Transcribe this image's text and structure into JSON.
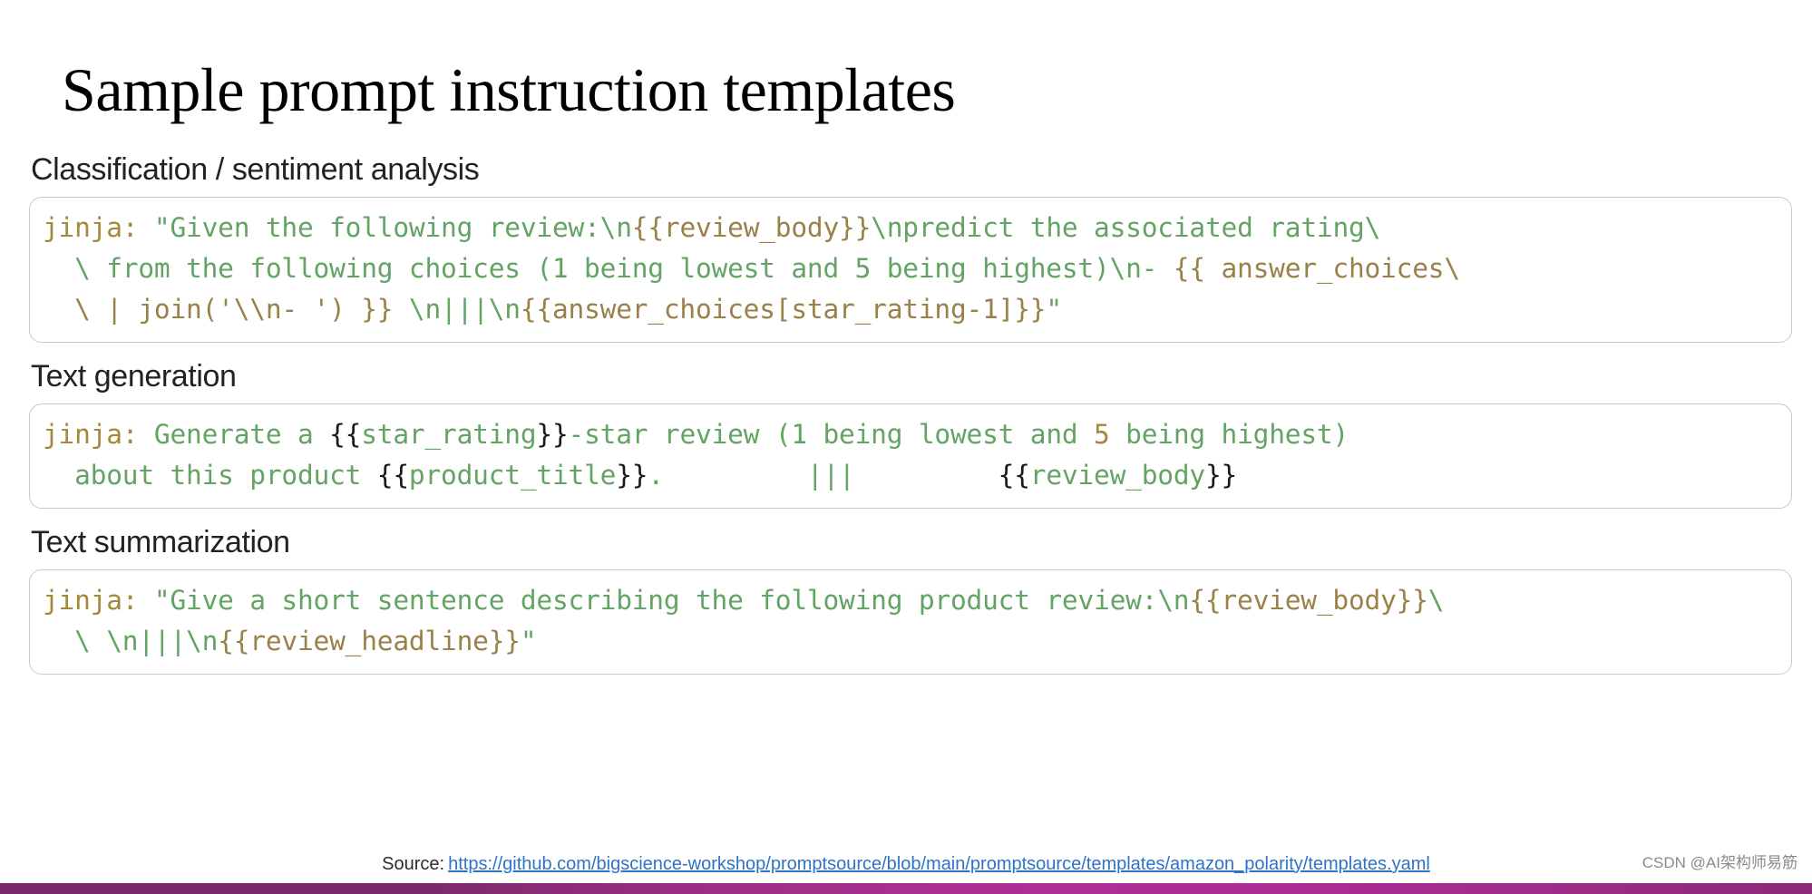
{
  "slide": {
    "title": "Sample prompt instruction templates"
  },
  "sections": [
    {
      "heading": "Classification / sentiment analysis",
      "lines": [
        {
          "plain": "jinja: \"Given the following review:\\n{{review_body}}\\npredict the associated rating\\",
          "tokens": [
            {
              "text": "jinja:",
              "type": "key"
            },
            {
              "text": " \"Given the following review:\\n",
              "type": "str"
            },
            {
              "text": "{{review_body}}",
              "type": "var"
            },
            {
              "text": "\\npredict the associated rating\\",
              "type": "str"
            }
          ]
        },
        {
          "plain": "  \\ from the following choices (1 being lowest and 5 being highest)\\n- {{ answer_choices\\",
          "tokens": [
            {
              "text": "  \\ from the following choices (1 being lowest and 5 being highest)\\n- ",
              "type": "str"
            },
            {
              "text": "{{ answer_choices\\",
              "type": "var"
            }
          ]
        },
        {
          "plain": "  \\ | join('\\\\n- ') }} \\n|||\\n{{answer_choices[star_rating-1]}}\"",
          "tokens": [
            {
              "text": "  \\ | join('\\\\n- ') }}",
              "type": "var"
            },
            {
              "text": " \\n|||\\n",
              "type": "str"
            },
            {
              "text": "{{answer_choices[star_rating-1]}}",
              "type": "var"
            },
            {
              "text": "\"",
              "type": "str"
            }
          ]
        }
      ]
    },
    {
      "heading": "Text generation",
      "lines": [
        {
          "plain": "jinja: Generate a {{star_rating}}-star review (1 being lowest and 5 being highest)",
          "tokens": [
            {
              "text": "jinja:",
              "type": "key"
            },
            {
              "text": " Generate a ",
              "type": "str"
            },
            {
              "text": "{{",
              "type": "brace"
            },
            {
              "text": "star_rating",
              "type": "str"
            },
            {
              "text": "}}",
              "type": "brace"
            },
            {
              "text": "-star review (1 being lowest and ",
              "type": "str"
            },
            {
              "text": "5",
              "type": "num"
            },
            {
              "text": " being highest)",
              "type": "str"
            }
          ]
        },
        {
          "plain": "  about this product {{product_title}}.      |||      {{review_body}}",
          "tokens": [
            {
              "text": "  about this product ",
              "type": "str"
            },
            {
              "text": "{{",
              "type": "brace"
            },
            {
              "text": "product_title",
              "type": "str"
            },
            {
              "text": "}}",
              "type": "brace"
            },
            {
              "text": ".         |||         ",
              "type": "str"
            },
            {
              "text": "{{",
              "type": "brace"
            },
            {
              "text": "review_body",
              "type": "str"
            },
            {
              "text": "}}",
              "type": "brace"
            }
          ]
        }
      ]
    },
    {
      "heading": "Text summarization",
      "lines": [
        {
          "plain": "jinja: \"Give a short sentence describing the following product review:\\n{{review_body}}\\",
          "tokens": [
            {
              "text": "jinja:",
              "type": "key"
            },
            {
              "text": " \"Give a short sentence describing the following product review:\\n",
              "type": "str"
            },
            {
              "text": "{{review_body}}",
              "type": "var"
            },
            {
              "text": "\\",
              "type": "str"
            }
          ]
        },
        {
          "plain": "  \\ \\n|||\\n{{review_headline}}\"",
          "tokens": [
            {
              "text": "  \\ ",
              "type": "str"
            },
            {
              "text": "\\n|||\\n",
              "type": "str"
            },
            {
              "text": "{{review_headline}}",
              "type": "var"
            },
            {
              "text": "\"",
              "type": "str"
            }
          ]
        }
      ]
    }
  ],
  "footer": {
    "source_label": "Source:",
    "source_url": "https://github.com/bigscience-workshop/promptsource/blob/main/promptsource/templates/amazon_polarity/templates.yaml",
    "watermark": "CSDN @AI架构师易筋"
  },
  "colors": {
    "string_green": "#63a363",
    "variable_brown": "#9a8049",
    "key_gold": "#a5883a",
    "brace_dark": "#1a1a1a",
    "link_blue": "#2f73c7",
    "card_border": "#c9c9c9",
    "strip_magenta": "#a82d90"
  }
}
